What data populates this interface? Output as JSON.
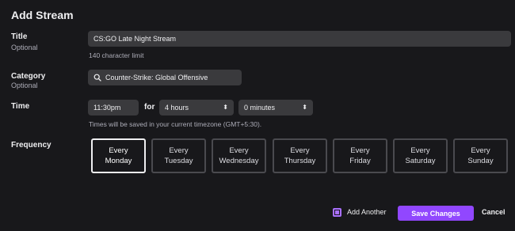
{
  "dialog": {
    "title": "Add Stream"
  },
  "fields": {
    "title": {
      "label": "Title",
      "sublabel": "Optional",
      "value": "CS:GO Late Night Stream",
      "hint": "140 character limit"
    },
    "category": {
      "label": "Category",
      "sublabel": "Optional",
      "value": "Counter-Strike: Global Offensive",
      "icon": "search-icon"
    },
    "time": {
      "label": "Time",
      "start": "11:30pm",
      "for_label": "for",
      "hours": "4 hours",
      "minutes": "0 minutes",
      "hint": "Times will be saved in your current timezone (GMT+5:30)."
    },
    "frequency": {
      "label": "Frequency",
      "days": [
        {
          "top": "Every",
          "bottom": "Monday",
          "selected": true
        },
        {
          "top": "Every",
          "bottom": "Tuesday",
          "selected": false
        },
        {
          "top": "Every",
          "bottom": "Wednesday",
          "selected": false
        },
        {
          "top": "Every",
          "bottom": "Thursday",
          "selected": false
        },
        {
          "top": "Every",
          "bottom": "Friday",
          "selected": false
        },
        {
          "top": "Every",
          "bottom": "Saturday",
          "selected": false
        },
        {
          "top": "Every",
          "bottom": "Sunday",
          "selected": false
        }
      ]
    }
  },
  "footer": {
    "add_another_label": "Add Another",
    "add_another_checked": true,
    "save_label": "Save Changes",
    "cancel_label": "Cancel"
  },
  "colors": {
    "background": "#18181b",
    "input": "#3a3a3d",
    "accent": "#9147ff",
    "checkbox": "#a970ff"
  }
}
